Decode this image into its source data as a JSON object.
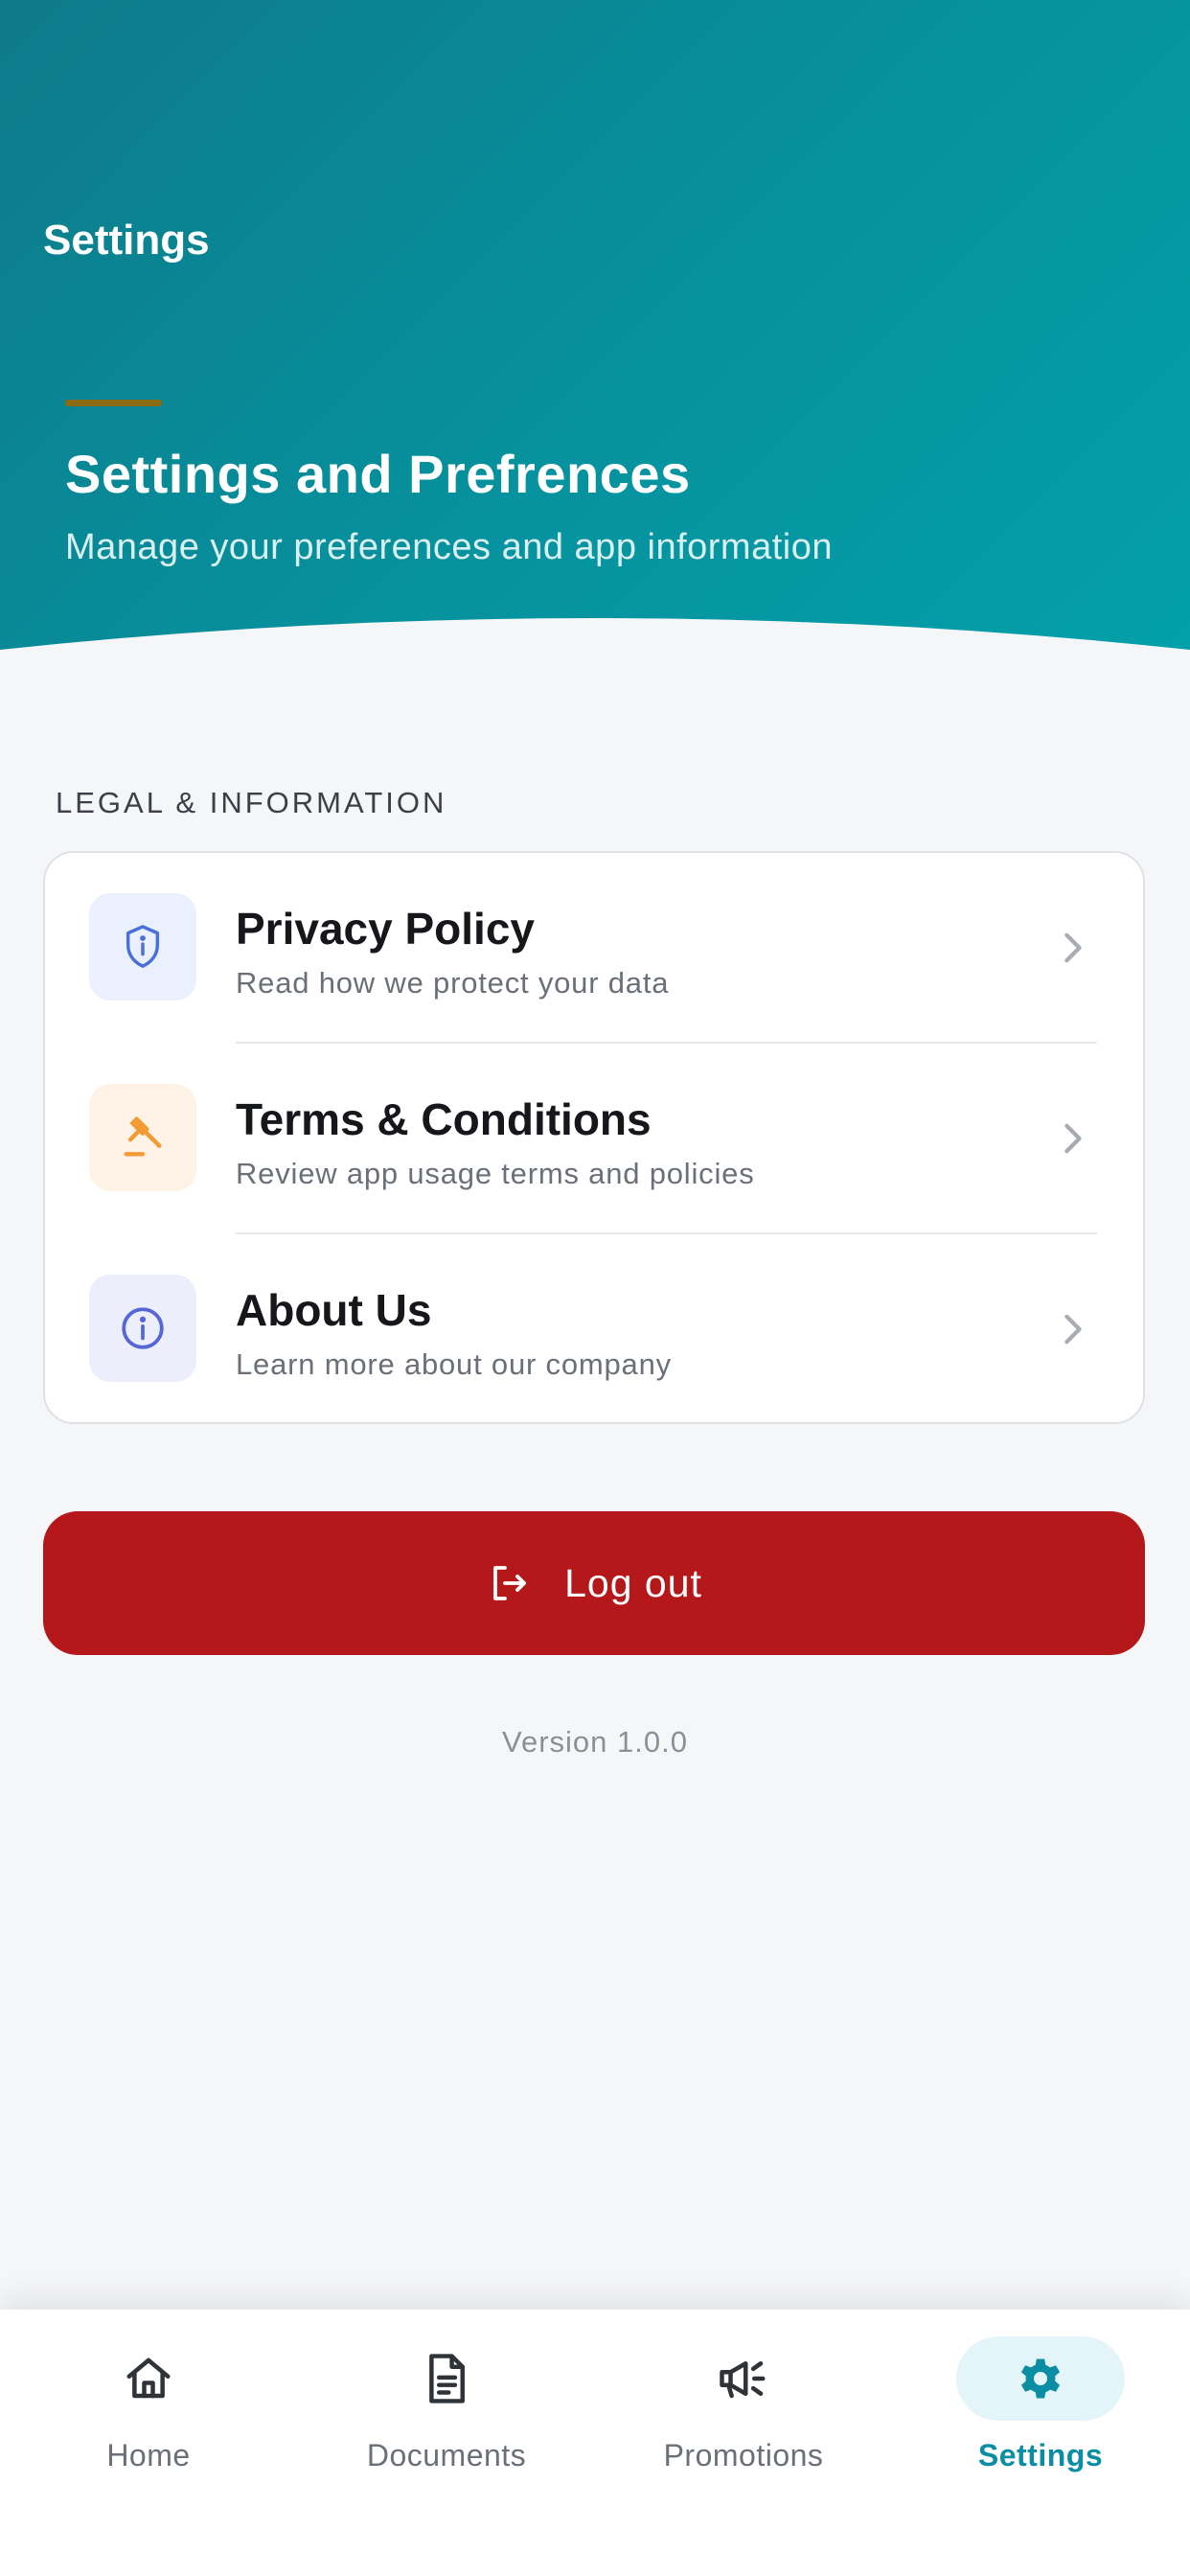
{
  "header": {
    "app_title": "Settings",
    "hero_title": "Settings and Prefrences",
    "hero_subtitle": "Manage your preferences and app information"
  },
  "section": {
    "label": "LEGAL & INFORMATION",
    "items": [
      {
        "title": "Privacy Policy",
        "description": "Read how we protect your data",
        "icon": "shield-icon",
        "icon_color": "#4a6fd6",
        "icon_bg": "#eaf0fd"
      },
      {
        "title": "Terms & Conditions",
        "description": "Review app usage terms and policies",
        "icon": "gavel-icon",
        "icon_color": "#f29a33",
        "icon_bg": "#fff3e8"
      },
      {
        "title": "About Us",
        "description": "Learn more about our company",
        "icon": "info-icon",
        "icon_color": "#5566d6",
        "icon_bg": "#eceefc"
      }
    ]
  },
  "logout": {
    "label": "Log out",
    "color": "#b4181b"
  },
  "version": "Version 1.0.0",
  "nav": {
    "active": "Settings",
    "accent_color": "#0b8ea3",
    "items": [
      {
        "label": "Home",
        "icon": "home-icon"
      },
      {
        "label": "Documents",
        "icon": "document-icon"
      },
      {
        "label": "Promotions",
        "icon": "megaphone-icon"
      },
      {
        "label": "Settings",
        "icon": "gear-icon"
      }
    ]
  }
}
